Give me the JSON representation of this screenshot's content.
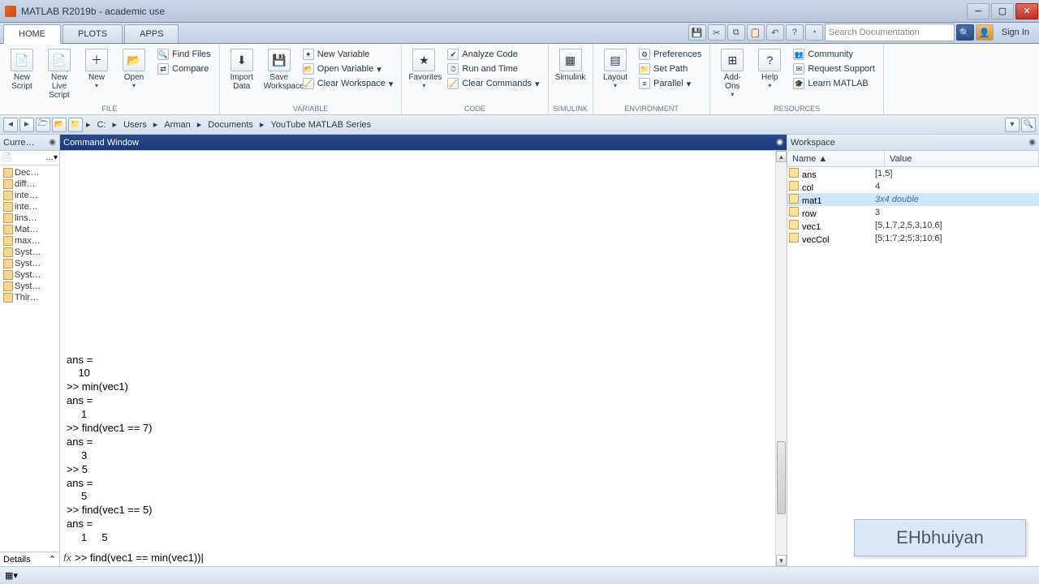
{
  "title": "MATLAB R2019b - academic use",
  "tabs": [
    "HOME",
    "PLOTS",
    "APPS"
  ],
  "active_tab": 0,
  "search_placeholder": "Search Documentation",
  "signin": "Sign In",
  "toolstrip": {
    "file": {
      "label": "FILE",
      "new_script": "New\nScript",
      "new_live": "New\nLive Script",
      "new": "New",
      "open": "Open",
      "find_files": "Find Files",
      "compare": "Compare"
    },
    "variable": {
      "label": "VARIABLE",
      "import": "Import\nData",
      "save_ws": "Save\nWorkspace",
      "new_var": "New Variable",
      "open_var": "Open Variable",
      "clear_ws": "Clear Workspace"
    },
    "code": {
      "label": "CODE",
      "favorites": "Favorites",
      "analyze": "Analyze Code",
      "run_time": "Run and Time",
      "clear_cmd": "Clear Commands"
    },
    "simulink": {
      "label": "SIMULINK",
      "btn": "Simulink"
    },
    "environment": {
      "label": "ENVIRONMENT",
      "layout": "Layout",
      "prefs": "Preferences",
      "setpath": "Set Path",
      "parallel": "Parallel"
    },
    "addons": {
      "btn": "Add-Ons"
    },
    "resources": {
      "label": "RESOURCES",
      "help": "Help",
      "community": "Community",
      "support": "Request Support",
      "learn": "Learn MATLAB"
    }
  },
  "breadcrumb": [
    "C:",
    "Users",
    "Arman",
    "Documents",
    "YouTube MATLAB Series"
  ],
  "current_folder": {
    "title": "Curre…",
    "items": [
      "Dec…",
      "diff…",
      "inte…",
      "inte…",
      "lins…",
      "Mat…",
      "max…",
      "Syst…",
      "Syst…",
      "Syst…",
      "Syst…",
      "Thir…"
    ]
  },
  "details_label": "Details",
  "command_window": {
    "title": "Command Window",
    "lines": [
      "ans =",
      "",
      "    10",
      "",
      ">> min(vec1)",
      "",
      "ans =",
      "",
      "     1",
      "",
      ">> find(vec1 == 7)",
      "",
      "ans =",
      "",
      "     3",
      "",
      ">> 5",
      "",
      "ans =",
      "",
      "     5",
      "",
      ">> find(vec1 == 5)",
      "",
      "ans =",
      "",
      "     1     5",
      ""
    ],
    "input": ">> find(vec1 == min(vec1))"
  },
  "workspace": {
    "title": "Workspace",
    "cols": [
      "Name ▲",
      "Value"
    ],
    "rows": [
      {
        "name": "ans",
        "value": "[1,5]"
      },
      {
        "name": "col",
        "value": "4"
      },
      {
        "name": "mat1",
        "value": "3x4 double",
        "selected": true,
        "italic": true
      },
      {
        "name": "row",
        "value": "3"
      },
      {
        "name": "vec1",
        "value": "[5,1,7,2,5,3,10,6]"
      },
      {
        "name": "vecCol",
        "value": "[5;1;7;2;5;3;10;6]"
      }
    ]
  },
  "watermark": "EHbhuiyan"
}
